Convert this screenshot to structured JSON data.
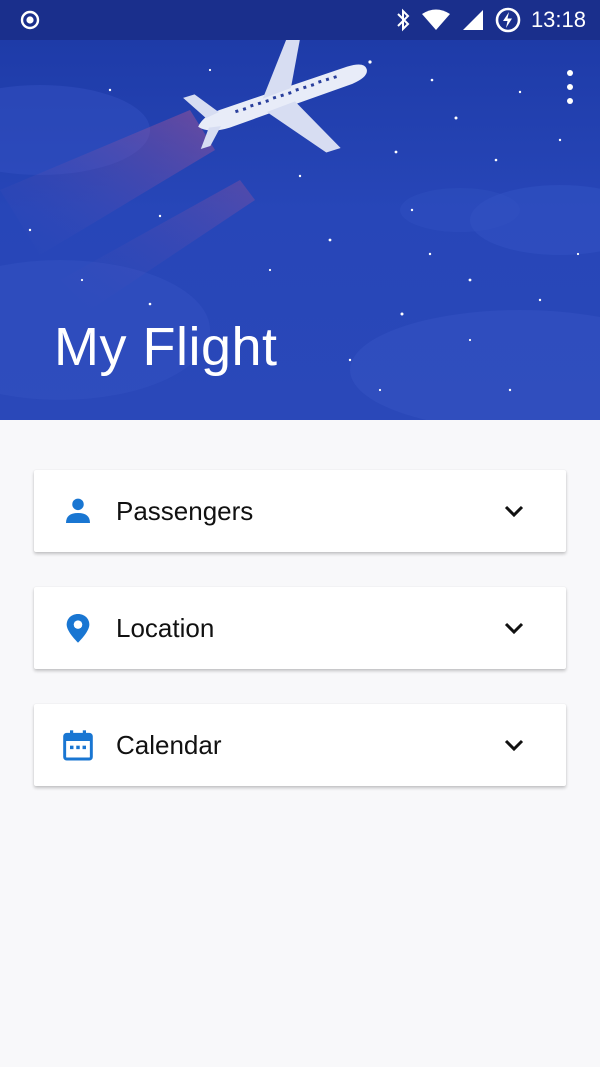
{
  "status_bar": {
    "time": "13:18",
    "icons": [
      "radio-icon",
      "bluetooth-icon",
      "wifi-icon",
      "signal-icon",
      "battery-charging-icon"
    ]
  },
  "header": {
    "title": "My Flight",
    "menu_icon": "more-vert-icon",
    "illustration": "airplane-night-sky"
  },
  "sections": [
    {
      "label": "Passengers",
      "icon": "person-icon",
      "toggle_icon": "chevron-down-icon"
    },
    {
      "label": "Location",
      "icon": "location-pin-icon",
      "toggle_icon": "chevron-down-icon"
    },
    {
      "label": "Calendar",
      "icon": "calendar-icon",
      "toggle_icon": "chevron-down-icon"
    }
  ],
  "colors": {
    "status_bar": "#1a2f8c",
    "hero": "#2746b8",
    "accent": "#1976d2",
    "background": "#f8f8fa"
  }
}
